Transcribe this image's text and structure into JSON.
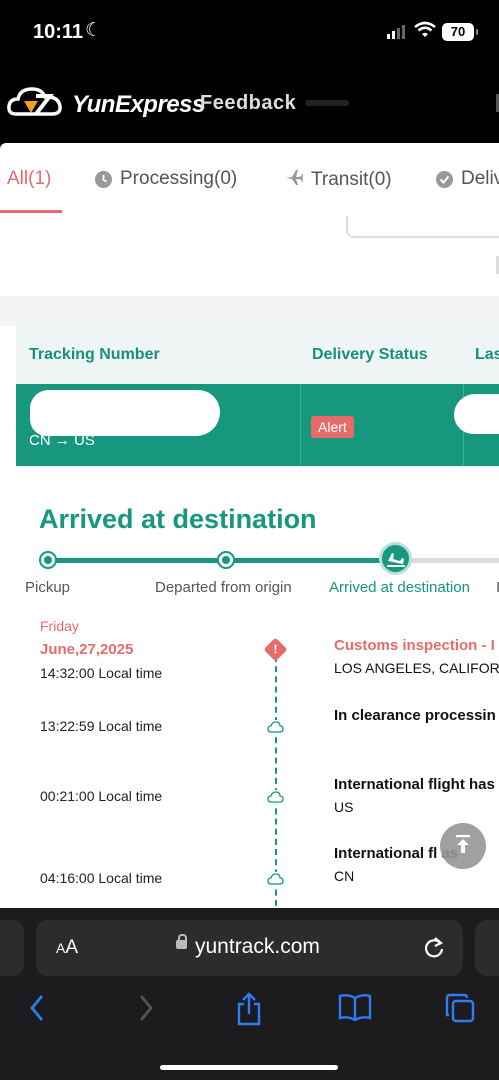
{
  "status_bar": {
    "time": "10:11",
    "battery": "70"
  },
  "header": {
    "brand": "YunExpress",
    "feedback": "Feedback"
  },
  "tabs": [
    {
      "label": "All(1)"
    },
    {
      "label": "Processing(0)"
    },
    {
      "label": "Transit(0)"
    },
    {
      "label": "Deliv"
    }
  ],
  "table": {
    "headers": {
      "tracking": "Tracking Number",
      "status": "Delivery Status",
      "last": "Las"
    },
    "row": {
      "route": "CN → US",
      "status_badge": "Alert"
    }
  },
  "detail": {
    "title": "Arrived at destination",
    "progress_steps": [
      "Pickup",
      "Departed from origin",
      "Arrived at destination",
      "I"
    ],
    "day": "Friday",
    "date": "June,27,2025",
    "events": [
      {
        "time": "14:32:00 Local time",
        "title": "Customs inspection - I",
        "location": "LOS ANGELES, CALIFOR"
      },
      {
        "time": "13:22:59 Local time",
        "title": "In clearance processin",
        "location": ""
      },
      {
        "time": "00:21:00 Local time",
        "title": "International flight has",
        "location": "US"
      },
      {
        "time": "04:16:00 Local time",
        "title": "International fl   as",
        "location": "CN"
      }
    ]
  },
  "browser": {
    "aa_label": "AA",
    "url": "yuntrack.com"
  },
  "colors": {
    "brand_green": "#17977e",
    "alert_red": "#e86b6b"
  }
}
